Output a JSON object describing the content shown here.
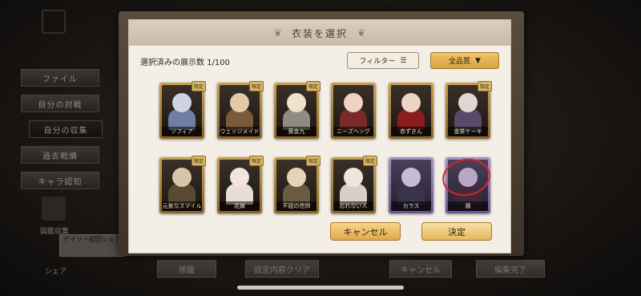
{
  "background": {
    "menu": [
      "ファイル",
      "自分の対戦",
      "自分の収集",
      "過去戦績",
      "キャラ認知"
    ],
    "active_index": 2,
    "collection_label": "図鑑収集",
    "share_label": "シェア",
    "tooltip": "デイリー初回シェア",
    "bottom_buttons": [
      "居籠",
      "設定内容クリア",
      "キャンセル",
      "編集完了"
    ]
  },
  "dialog": {
    "title": "衣装を選択",
    "count_text": "選択済みの展示数 1/100",
    "filter_label": "フィルター",
    "quality_label": "全品質",
    "cancel_label": "キャンセル",
    "ok_label": "決定",
    "cards": [
      {
        "name": "ソフィア",
        "badge": "限定",
        "tier": "gold",
        "c1": "#cdd3e2",
        "c2": "#6f7fa4"
      },
      {
        "name": "ウェッジメイド",
        "badge": "限定",
        "tier": "gold",
        "c1": "#e3c9a6",
        "c2": "#7a5a3a"
      },
      {
        "name": "黄金九",
        "badge": "限定",
        "tier": "gold",
        "c1": "#eee2c9",
        "c2": "#8e8b82"
      },
      {
        "name": "ニーズヘッグ",
        "badge": "",
        "tier": "gold",
        "c1": "#f0d2c2",
        "c2": "#7a2a28"
      },
      {
        "name": "赤ずきん",
        "badge": "",
        "tier": "gold",
        "c1": "#ecd4c4",
        "c2": "#8a1e1e"
      },
      {
        "name": "金茶ケーキ",
        "badge": "限定",
        "tier": "gold",
        "c1": "#e2d6d2",
        "c2": "#5a4a6a"
      },
      {
        "name": "元気なスマイル",
        "badge": "限定",
        "tier": "gold",
        "c1": "#d8c4a6",
        "c2": "#5a4a32"
      },
      {
        "name": "花嫁",
        "badge": "限定",
        "tier": "gold",
        "c1": "#f4e4dc",
        "c2": "#e8dcd6"
      },
      {
        "name": "不屈の信仰",
        "badge": "限定",
        "tier": "gold",
        "c1": "#e6d2b8",
        "c2": "#6a5a42"
      },
      {
        "name": "忘れない人",
        "badge": "限定",
        "tier": "gold",
        "c1": "#efe6da",
        "c2": "#d8d0c6"
      },
      {
        "name": "カラス",
        "badge": "",
        "tier": "purple",
        "c1": "#c8bcd2",
        "c2": "#3a344a"
      },
      {
        "name": "鴉",
        "badge": "",
        "tier": "purple",
        "c1": "#b6a8c4",
        "c2": "#3e2a3c"
      }
    ]
  }
}
